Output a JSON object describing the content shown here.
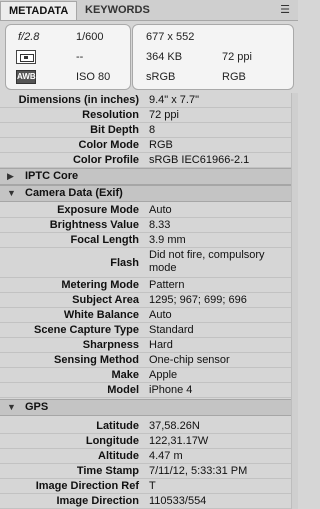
{
  "tabs": [
    {
      "label": "METADATA",
      "active": true
    },
    {
      "label": "KEYWORDS",
      "active": false
    }
  ],
  "tab_menu_icon": "panel-menu-icon",
  "camera": {
    "aperture": "f/2.8",
    "shutter": "1/600",
    "metering_value": "--",
    "exposure_value": "--",
    "white_balance": "AWB",
    "iso": "ISO 80"
  },
  "file": {
    "dimensions": "677 x 552",
    "size": "364 KB",
    "resolution": "72 ppi",
    "color_profile": "sRGB",
    "color_mode": "RGB"
  },
  "file_props": [
    {
      "key": "Dimensions (in inches)",
      "value": "9.4\" x 7.7\""
    },
    {
      "key": "Resolution",
      "value": "72 ppi"
    },
    {
      "key": "Bit Depth",
      "value": "8"
    },
    {
      "key": "Color Mode",
      "value": "RGB"
    },
    {
      "key": "Color Profile",
      "value": "sRGB IEC61966-2.1"
    }
  ],
  "sections": {
    "iptc": {
      "title": "IPTC Core",
      "expanded": false
    },
    "exif": {
      "title": "Camera Data (Exif)",
      "expanded": true
    },
    "gps": {
      "title": "GPS",
      "expanded": true
    }
  },
  "exif": [
    {
      "key": "Exposure Mode",
      "value": "Auto"
    },
    {
      "key": "Brightness Value",
      "value": "8.33"
    },
    {
      "key": "Focal Length",
      "value": "3.9 mm"
    },
    {
      "key": "Flash",
      "value": "Did not fire, compulsory mode"
    },
    {
      "key": "Metering Mode",
      "value": "Pattern"
    },
    {
      "key": "Subject Area",
      "value": "1295; 967; 699; 696"
    },
    {
      "key": "White Balance",
      "value": "Auto"
    },
    {
      "key": "Scene Capture Type",
      "value": "Standard"
    },
    {
      "key": "Sharpness",
      "value": "Hard"
    },
    {
      "key": "Sensing Method",
      "value": "One-chip sensor"
    },
    {
      "key": "Make",
      "value": "Apple"
    },
    {
      "key": "Model",
      "value": "iPhone 4"
    }
  ],
  "gps": [
    {
      "key": "Latitude",
      "value": "37,58.26N"
    },
    {
      "key": "Longitude",
      "value": "122,31.17W"
    },
    {
      "key": "Altitude",
      "value": "4.47 m"
    },
    {
      "key": "Time Stamp",
      "value": "7/11/12, 5:33:31 PM"
    },
    {
      "key": "Image Direction Ref",
      "value": "T"
    },
    {
      "key": "Image Direction",
      "value": "110533/554"
    }
  ]
}
